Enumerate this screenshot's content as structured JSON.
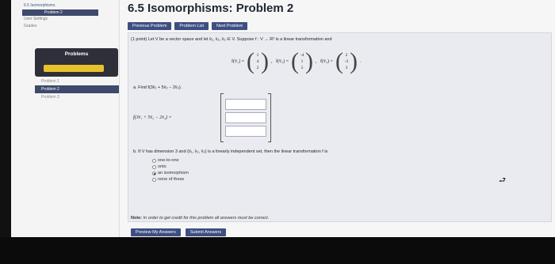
{
  "sidebar": {
    "crumb": "6.5 Isomorphisms",
    "current": "Problem 2",
    "links": [
      "User Settings",
      "Grades"
    ],
    "problems_title": "Problems",
    "problem_list": [
      "Problem 1",
      "Problem 2",
      "Problem 3"
    ]
  },
  "page": {
    "title": "6.5 Isomorphisms: Problem 2",
    "nav": [
      "Previous Problem",
      "Problem List",
      "Next Problem"
    ]
  },
  "question": {
    "intro": "(1 point) Let V be a vector space and let v̄₁, v̄₂, v̄₃ ∈ V. Suppose f : V → R³ is a linear transformation and",
    "defs": [
      {
        "label": "f(v̄₁) =",
        "vector": [
          "1",
          "4",
          "2"
        ]
      },
      {
        "label": "f(v̄₂) =",
        "vector": [
          "-4",
          "1",
          "5"
        ]
      },
      {
        "label": "f(v̄₃) =",
        "vector": [
          "2",
          "-3",
          "3"
        ]
      }
    ],
    "part_a": "a. Find f(3v̄₁ + 5v̄₂ − 2v̄₃).",
    "answer_lhs": "f(3v̄₁ + 5v̄₂ − 2v̄₃) =",
    "part_b": "b. If V has dimension 3 and {v̄₁, v̄₂, v̄₃} is a linearly independent set, then the linear transformation f is",
    "options": [
      "one-to-one",
      "onto",
      "an isomorphism",
      "none of these"
    ],
    "selected_option": "an isomorphism",
    "note_label": "Note:",
    "note_text": "In order to get credit for this problem all answers must be correct."
  },
  "actions": {
    "preview": "Preview My Answers",
    "submit": "Submit Answers"
  }
}
